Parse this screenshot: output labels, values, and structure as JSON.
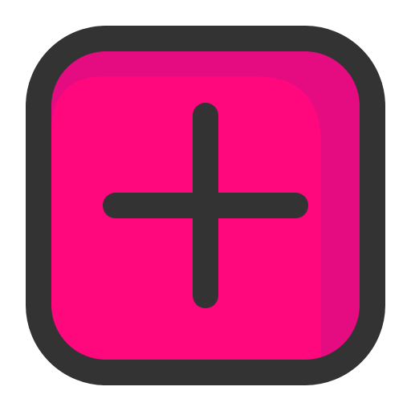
{
  "icon": {
    "name": "plus-icon",
    "colors": {
      "fill_main": "#FF077D",
      "fill_shade": "#E50C82",
      "outline": "#333333",
      "background": "#FFFFFF"
    }
  }
}
